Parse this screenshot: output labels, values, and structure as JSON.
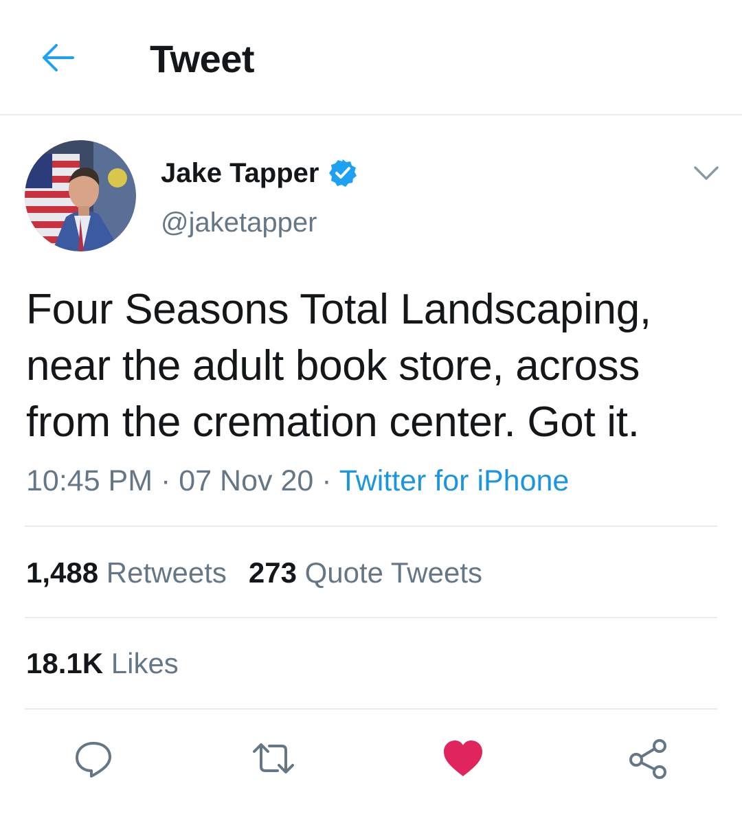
{
  "header": {
    "back_icon": "arrow-left-icon",
    "title": "Tweet"
  },
  "author": {
    "name": "Jake Tapper",
    "handle": "@jaketapper",
    "verified": true,
    "verified_icon": "verified-badge-icon"
  },
  "tweet": {
    "text": "Four Seasons Total Landscaping, near the adult book store, across from the cremation center. Got it.",
    "time": "10:45 PM",
    "date": "07 Nov 20",
    "source": "Twitter for iPhone",
    "separator": " · "
  },
  "stats": {
    "retweets_count": "1,488",
    "retweets_label": "Retweets",
    "quotes_count": "273",
    "quotes_label": "Quote Tweets",
    "likes_count": "18.1K",
    "likes_label": "Likes"
  },
  "actions": [
    {
      "icon": "reply-icon"
    },
    {
      "icon": "retweet-icon"
    },
    {
      "icon": "like-heart-icon",
      "active": true
    },
    {
      "icon": "share-icon"
    }
  ],
  "colors": {
    "accent": "#1da1f2",
    "like_active": "#e0245e",
    "secondary_text": "#657786",
    "divider": "#e6ecf0"
  }
}
